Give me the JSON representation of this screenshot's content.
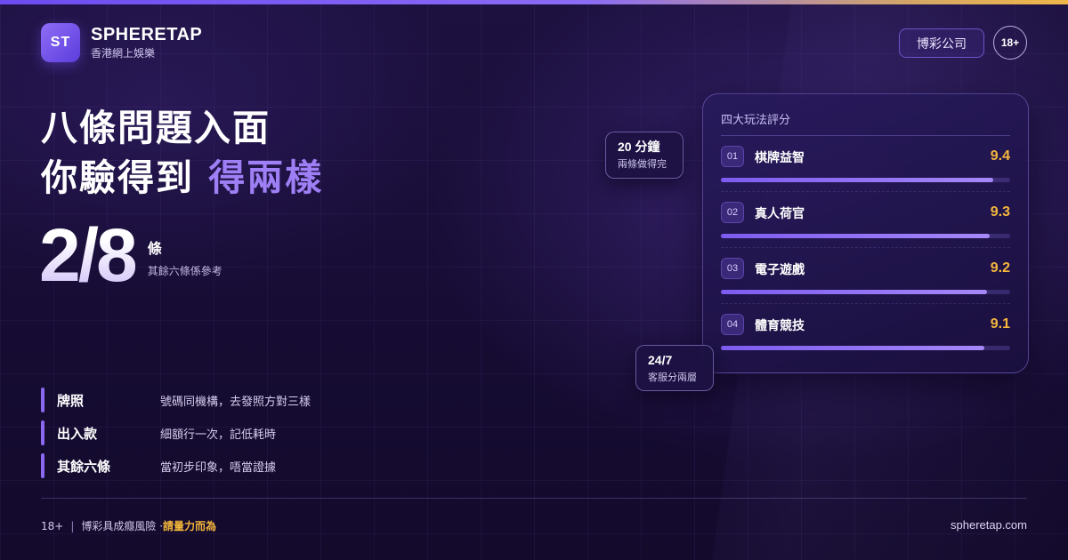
{
  "brand": {
    "logo": "ST",
    "name": "SPHERETAP",
    "subtitle": "香港網上娛樂"
  },
  "header": {
    "tag_label": "博彩公司",
    "age_badge": "18+"
  },
  "headline": {
    "line1": "八條問題入面",
    "line2_prefix": "你驗得到 ",
    "line2_accent": "得兩樣"
  },
  "stat": {
    "value": "2/8",
    "unit": "條",
    "note": "其餘六條係參考"
  },
  "info_rows": [
    {
      "label": "牌照",
      "desc": "號碼同機構，去發照方對三樣"
    },
    {
      "label": "出入款",
      "desc": "細額行一次，記低耗時"
    },
    {
      "label": "其餘六條",
      "desc": "當初步印象，唔當證據"
    }
  ],
  "card": {
    "title": "四大玩法評分",
    "games": [
      {
        "index": "01",
        "name": "棋牌益智",
        "score": "9.4",
        "fill_fraction": 0.94
      },
      {
        "index": "02",
        "name": "真人荷官",
        "score": "9.3",
        "fill_fraction": 0.93
      },
      {
        "index": "03",
        "name": "電子遊戲",
        "score": "9.2",
        "fill_fraction": 0.92
      },
      {
        "index": "04",
        "name": "體育競技",
        "score": "9.1",
        "fill_fraction": 0.91
      }
    ]
  },
  "chips": {
    "time": {
      "main": "20 分鐘",
      "sub": "兩條做得完"
    },
    "service": {
      "main": "24/7",
      "sub": "客服分兩層"
    }
  },
  "footer": {
    "age": "18+",
    "separator": "|",
    "warning": "博彩具成癮風險 · ",
    "warning_strong": "請量力而為",
    "site": "spheretap.com"
  },
  "colors": {
    "accent": "#9f7ff5",
    "score": "#f6b73c",
    "background": "#170d33"
  }
}
